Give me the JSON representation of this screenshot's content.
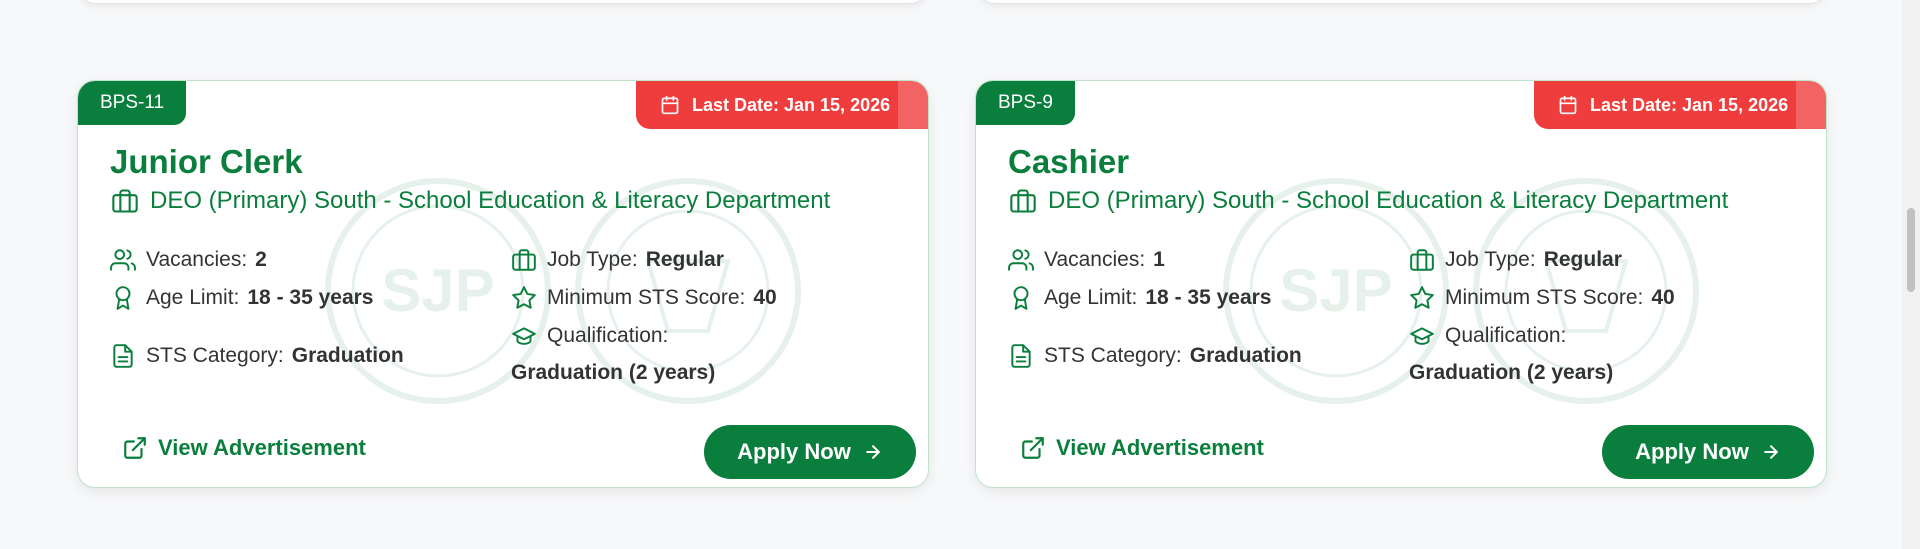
{
  "jobs": [
    {
      "bps": "BPS-11",
      "last_date": "Last Date: Jan 15, 2026",
      "title": "Junior Clerk",
      "department": "DEO (Primary) South - School Education & Literacy Department",
      "vacancies_label": "Vacancies:",
      "vacancies": "2",
      "age_label": "Age Limit:",
      "age": "18 - 35 years",
      "sts_category_label": "STS Category:",
      "sts_category": "Graduation",
      "job_type_label": "Job Type:",
      "job_type": "Regular",
      "min_sts_label": "Minimum STS Score:",
      "min_sts": "40",
      "qualification_label": "Qualification:",
      "qualification": "Graduation (2 years)",
      "view_ad": "View Advertisement",
      "apply": "Apply Now"
    },
    {
      "bps": "BPS-9",
      "last_date": "Last Date: Jan 15, 2026",
      "title": "Cashier",
      "department": "DEO (Primary) South - School Education & Literacy Department",
      "vacancies_label": "Vacancies:",
      "vacancies": "1",
      "age_label": "Age Limit:",
      "age": "18 - 35 years",
      "sts_category_label": "STS Category:",
      "sts_category": "Graduation",
      "job_type_label": "Job Type:",
      "job_type": "Regular",
      "min_sts_label": "Minimum STS Score:",
      "min_sts": "40",
      "qualification_label": "Qualification:",
      "qualification": "Graduation (2 years)",
      "view_ad": "View Advertisement",
      "apply": "Apply Now"
    }
  ],
  "watermark_text": "SJP",
  "colors": {
    "primary": "#0a7e3c",
    "deadline": "#ef3d3d",
    "border": "#bfe3c9"
  },
  "icons": [
    "users-icon",
    "award-icon",
    "file-text-icon",
    "briefcase-icon",
    "star-icon",
    "graduation-cap-icon",
    "calendar-icon",
    "external-link-icon",
    "arrow-right-icon"
  ]
}
